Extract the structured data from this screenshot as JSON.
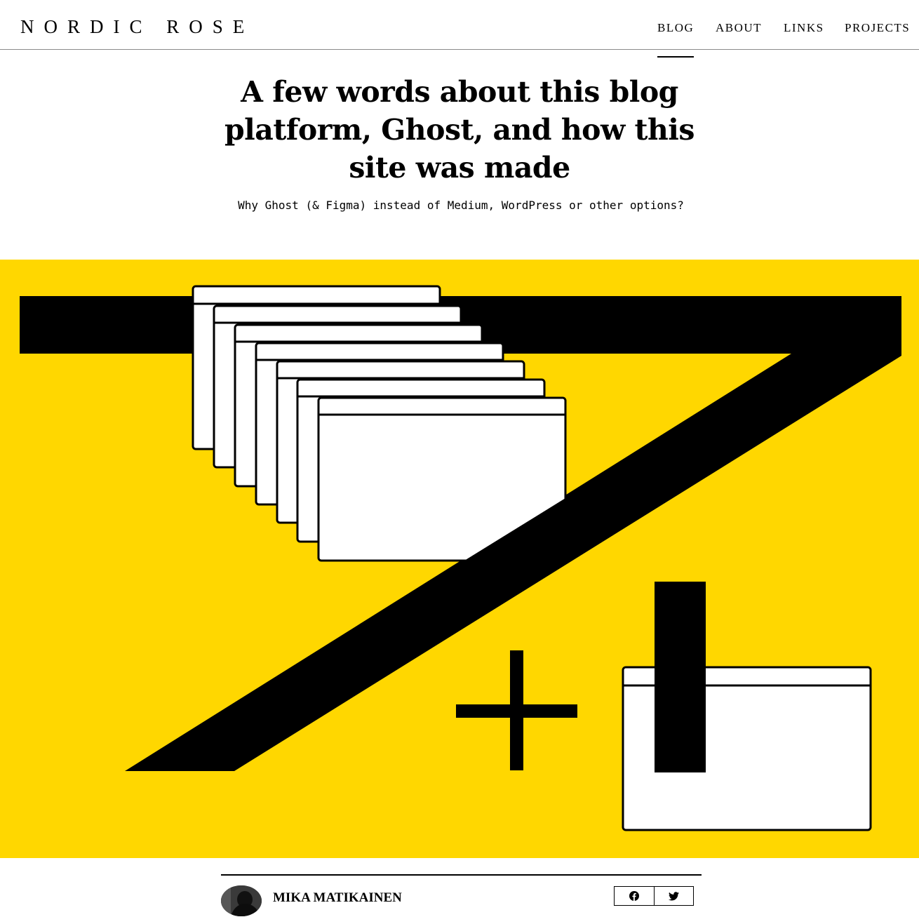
{
  "site": {
    "logo": "NORDIC ROSE"
  },
  "nav": {
    "items": [
      "BLOG",
      "ABOUT",
      "LINKS",
      "PROJECTS"
    ],
    "active": "BLOG"
  },
  "post": {
    "title": "A few words about this blog platform, Ghost, and how this site was made",
    "subtitle": "Why Ghost (& Figma) instead of Medium, WordPress or other options?",
    "hero_bg_color": "#ffd700"
  },
  "author": {
    "name": "MIKA MATIKAINEN"
  },
  "share": {
    "icons": [
      "facebook-icon",
      "twitter-icon"
    ]
  }
}
